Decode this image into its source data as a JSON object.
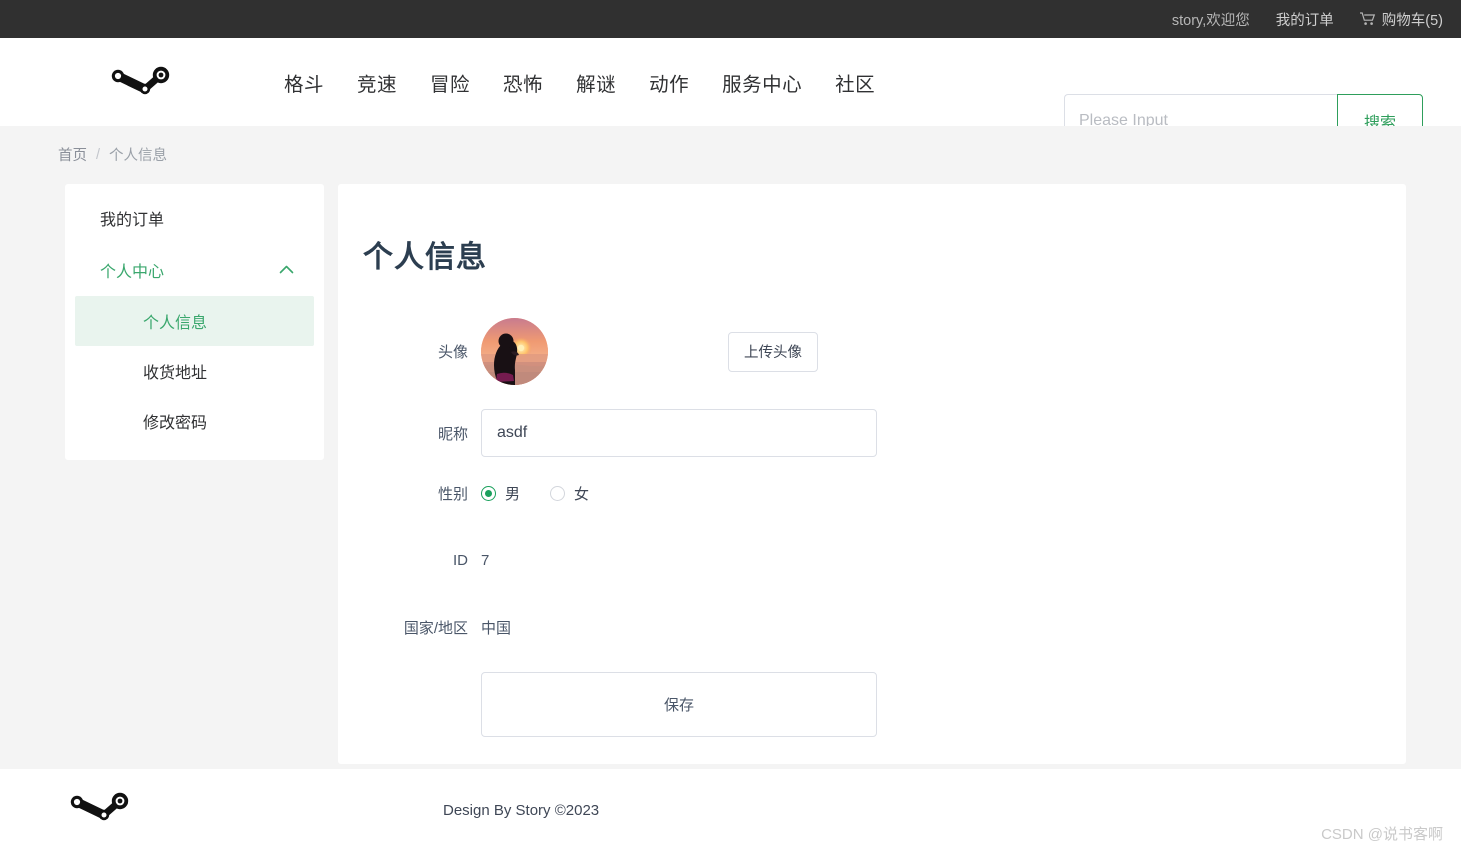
{
  "topbar": {
    "greeting": "story,欢迎您",
    "orders_label": "我的订单",
    "cart_icon": "shopping-cart-icon",
    "cart_label": "购物车(5)"
  },
  "header": {
    "logo_icon": "steam-logo-icon",
    "nav": [
      {
        "label": "格斗"
      },
      {
        "label": "竞速"
      },
      {
        "label": "冒险"
      },
      {
        "label": "恐怖"
      },
      {
        "label": "解谜"
      },
      {
        "label": "动作"
      },
      {
        "label": "服务中心"
      },
      {
        "label": "社区"
      }
    ],
    "search": {
      "placeholder": "Please Input",
      "value": "",
      "button_label": "搜索"
    }
  },
  "breadcrumb": {
    "home": "首页",
    "separator": "/",
    "current": "个人信息"
  },
  "sidebar": {
    "orders": "我的订单",
    "group_label": "个人中心",
    "chevron": "chevron-up-icon",
    "sub_items": [
      {
        "label": "个人信息",
        "active": true
      },
      {
        "label": "收货地址",
        "active": false
      },
      {
        "label": "修改密码",
        "active": false
      }
    ]
  },
  "main": {
    "title": "个人信息",
    "fields": {
      "avatar_label": "头像",
      "avatar_icon": "user-avatar-photo",
      "upload_label": "上传头像",
      "nickname_label": "昵称",
      "nickname_value": "asdf",
      "gender_label": "性别",
      "gender_male": "男",
      "gender_female": "女",
      "gender_selected": "男",
      "id_label": "ID",
      "id_value": "7",
      "country_label": "国家/地区",
      "country_value": "中国"
    },
    "save_label": "保存"
  },
  "footer": {
    "logo_icon": "steam-logo-icon",
    "text": "Design By Story ©2023"
  },
  "watermark": "CSDN @说书客啊",
  "colors": {
    "topbar_bg": "#303030",
    "page_bg": "#f4f4f4",
    "accent_green": "#3aa76d",
    "accent_green_light": "#e9f4ee",
    "radio_green": "#1aa05c",
    "search_border_green": "#2e9e5b",
    "title_color": "#2c3e50"
  }
}
